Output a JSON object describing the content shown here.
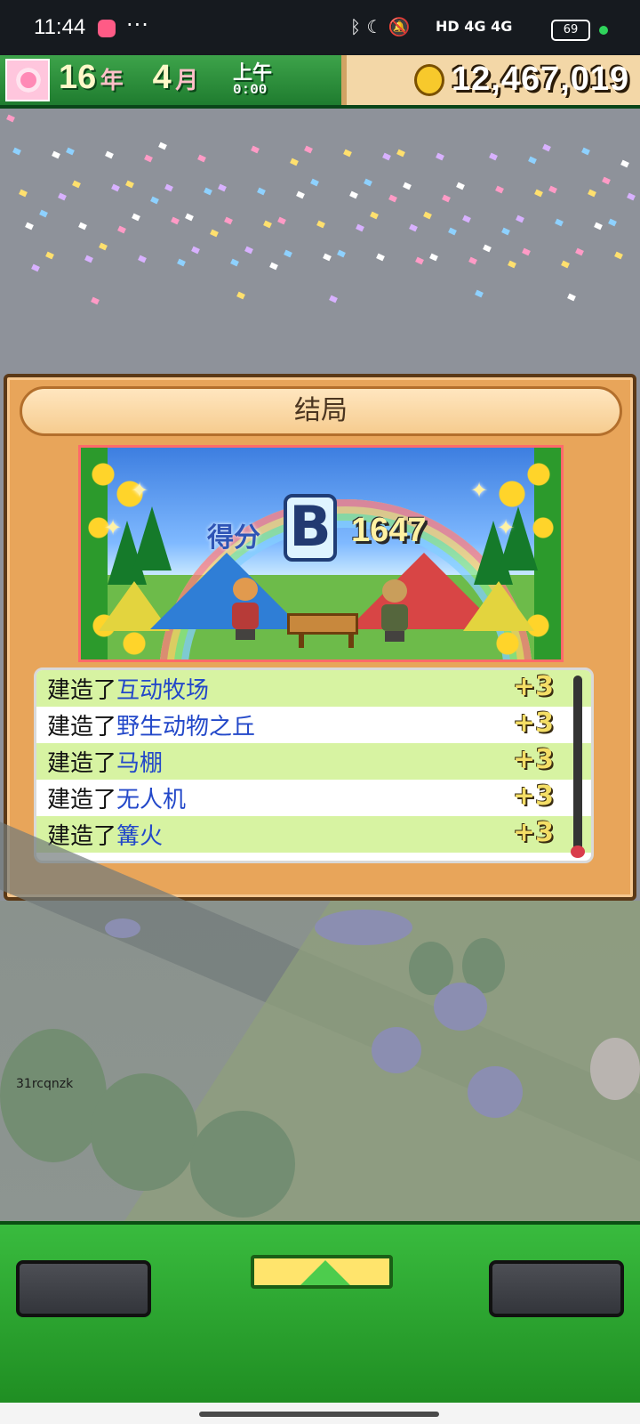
{
  "status_bar": {
    "time": "11:44",
    "more": "···",
    "system_icons": "ᛒ ☾ 🔕",
    "network": "HD 4G 4G",
    "battery": "69"
  },
  "top_bar": {
    "year": "16",
    "year_unit": "年",
    "month": "4",
    "month_unit": "月",
    "period": "上午",
    "clock": "0:00",
    "money": "12,467,019"
  },
  "dialog": {
    "title": "结局",
    "score_label": "得分",
    "grade": "B",
    "score": "1647",
    "items": [
      {
        "prefix": "建造了",
        "target": "互动牧场",
        "points": "+3"
      },
      {
        "prefix": "建造了",
        "target": "野生动物之丘",
        "points": "+3"
      },
      {
        "prefix": "建造了",
        "target": "马棚",
        "points": "+3"
      },
      {
        "prefix": "建造了",
        "target": "无人机",
        "points": "+3"
      },
      {
        "prefix": "建造了",
        "target": "篝火",
        "points": "+3"
      }
    ]
  },
  "watermark": "31rcqnzk",
  "icons": {
    "coin": "gold-coin-icon",
    "up": "up-arrow-icon",
    "settings": "flower-portrait"
  },
  "colors": {
    "accent_green": "#2b9c2d",
    "dialog_orange": "#e8a55a",
    "highlight_blue": "#2348c9"
  }
}
